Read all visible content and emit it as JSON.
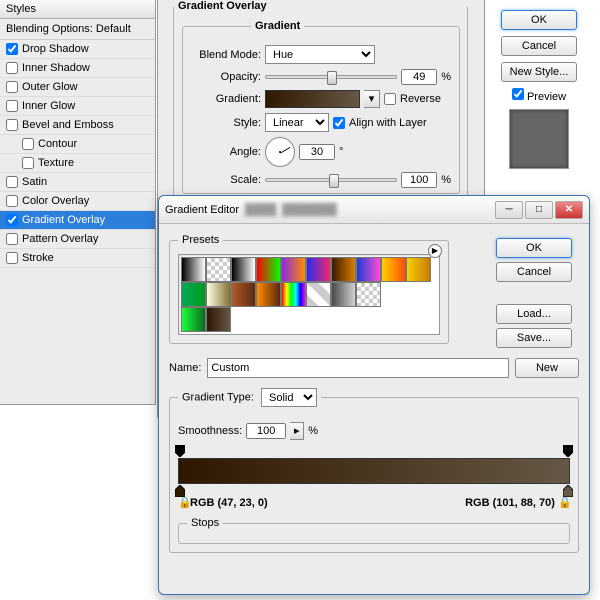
{
  "styles_panel": {
    "title": "Styles",
    "blending_label": "Blending Options: Default",
    "items": [
      {
        "label": "Drop Shadow",
        "checked": true,
        "indent": false
      },
      {
        "label": "Inner Shadow",
        "checked": false,
        "indent": false
      },
      {
        "label": "Outer Glow",
        "checked": false,
        "indent": false
      },
      {
        "label": "Inner Glow",
        "checked": false,
        "indent": false
      },
      {
        "label": "Bevel and Emboss",
        "checked": false,
        "indent": false
      },
      {
        "label": "Contour",
        "checked": false,
        "indent": true
      },
      {
        "label": "Texture",
        "checked": false,
        "indent": true
      },
      {
        "label": "Satin",
        "checked": false,
        "indent": false
      },
      {
        "label": "Color Overlay",
        "checked": false,
        "indent": false
      },
      {
        "label": "Gradient Overlay",
        "checked": true,
        "indent": false,
        "selected": true
      },
      {
        "label": "Pattern Overlay",
        "checked": false,
        "indent": false
      },
      {
        "label": "Stroke",
        "checked": false,
        "indent": false
      }
    ]
  },
  "gradient_overlay": {
    "title": "Gradient Overlay",
    "group_title": "Gradient",
    "blend_mode_label": "Blend Mode:",
    "blend_mode_value": "Hue",
    "opacity_label": "Opacity:",
    "opacity_value": "49",
    "opacity_unit": "%",
    "gradient_label": "Gradient:",
    "reverse_label": "Reverse",
    "style_label": "Style:",
    "style_value": "Linear",
    "align_label": "Align with Layer",
    "angle_label": "Angle:",
    "angle_value": "30",
    "angle_unit": "°",
    "scale_label": "Scale:",
    "scale_value": "100",
    "scale_unit": "%"
  },
  "right_buttons": {
    "ok": "OK",
    "cancel": "Cancel",
    "new_style": "New Style...",
    "preview_label": "Preview"
  },
  "editor": {
    "title": "Gradient Editor",
    "presets_label": "Presets",
    "ok": "OK",
    "cancel": "Cancel",
    "load": "Load...",
    "save": "Save...",
    "name_label": "Name:",
    "name_value": "Custom",
    "new_btn": "New",
    "type_label": "Gradient Type:",
    "type_value": "Solid",
    "smooth_label": "Smoothness:",
    "smooth_value": "100",
    "smooth_unit": "%",
    "rgb_left": "RGB (47, 23, 0)",
    "rgb_right": "RGB (101, 88, 70)",
    "stops_label": "Stops",
    "preset_colors": [
      "linear-gradient(90deg,#000,#fff)",
      "checker",
      "linear-gradient(90deg,#000,#fff)",
      "linear-gradient(90deg,#f00,#0f0)",
      "linear-gradient(90deg,#8A2BE2,#FF8C00)",
      "linear-gradient(90deg,#2a2af0,#f02a6a)",
      "linear-gradient(90deg,#3b1b00,#d97e00)",
      "linear-gradient(90deg,#1d3fd6,#ff4bd8)",
      "linear-gradient(90deg,#ffd000,#ff4d00)",
      "linear-gradient(90deg,#f5d000,#c77b00)",
      "linear-gradient(90deg,#0a5,#092)",
      "linear-gradient(90deg,#fffde8,#847233)",
      "linear-gradient(90deg,#b55a2a,#5a2a10)",
      "linear-gradient(90deg,#ff8a00,#5a2a10)",
      "linear-gradient(90deg,#f00,#ff0,#0f0,#0ff,#00f,#f0f)",
      "linear-gradient(45deg,#ccc 25%,#fff 25%,#fff 50%,#ccc 50%,#ccc 75%,#fff 75%)",
      "linear-gradient(90deg,#4a4a4a,#d0d0d0)",
      "checker",
      "",
      "",
      "linear-gradient(90deg,#1aff3d,#0a6b1d)",
      "linear-gradient(90deg,#2f1700,#655846)",
      "",
      "",
      "",
      "",
      "",
      "",
      "",
      ""
    ]
  }
}
